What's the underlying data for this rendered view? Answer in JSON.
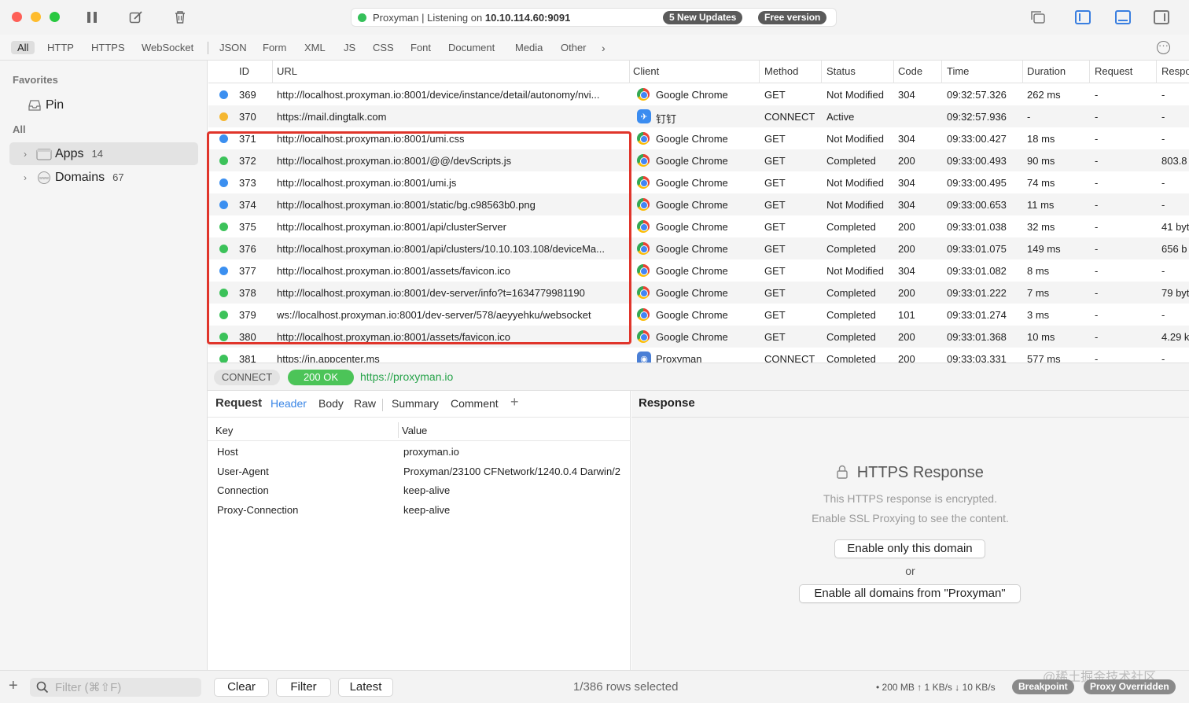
{
  "titlebar": {
    "app_status": "Proxyman | Listening on",
    "address": "10.10.114.60:9091",
    "updates_badge": "5 New Updates",
    "version_badge": "Free version"
  },
  "filters": [
    "All",
    "HTTP",
    "HTTPS",
    "WebSocket",
    "JSON",
    "Form",
    "XML",
    "JS",
    "CSS",
    "Font",
    "Document",
    "Media",
    "Other"
  ],
  "sidebar": {
    "favorites_heading": "Favorites",
    "pin_label": "Pin",
    "all_heading": "All",
    "apps_label": "Apps",
    "apps_count": "14",
    "domains_label": "Domains",
    "domains_count": "67"
  },
  "table": {
    "columns": [
      "ID",
      "URL",
      "Client",
      "Method",
      "Status",
      "Code",
      "Time",
      "Duration",
      "Request",
      "Respo"
    ],
    "rows": [
      {
        "dot": "#3b8ff0",
        "id": "369",
        "url": "http://localhost.proxyman.io:8001/device/instance/detail/autonomy/nvi...",
        "client": "Google Chrome",
        "client_icon": "chrome-icon",
        "method": "GET",
        "status": "Not Modified",
        "code": "304",
        "time": "09:32:57.326",
        "duration": "262 ms",
        "request": "-",
        "response": "-"
      },
      {
        "dot": "#f5b731",
        "id": "370",
        "url": "https://mail.dingtalk.com",
        "client": "钉钉",
        "client_icon": "dingtalk-icon",
        "method": "CONNECT",
        "status": "Active",
        "code": "",
        "time": "09:32:57.936",
        "duration": "-",
        "request": "-",
        "response": "-"
      },
      {
        "dot": "#3b8ff0",
        "id": "371",
        "url": "http://localhost.proxyman.io:8001/umi.css",
        "client": "Google Chrome",
        "client_icon": "chrome-icon",
        "method": "GET",
        "status": "Not Modified",
        "code": "304",
        "time": "09:33:00.427",
        "duration": "18 ms",
        "request": "-",
        "response": "-"
      },
      {
        "dot": "#3cc25a",
        "id": "372",
        "url": "http://localhost.proxyman.io:8001/@@/devScripts.js",
        "client": "Google Chrome",
        "client_icon": "chrome-icon",
        "method": "GET",
        "status": "Completed",
        "code": "200",
        "time": "09:33:00.493",
        "duration": "90 ms",
        "request": "-",
        "response": "803.8"
      },
      {
        "dot": "#3b8ff0",
        "id": "373",
        "url": "http://localhost.proxyman.io:8001/umi.js",
        "client": "Google Chrome",
        "client_icon": "chrome-icon",
        "method": "GET",
        "status": "Not Modified",
        "code": "304",
        "time": "09:33:00.495",
        "duration": "74 ms",
        "request": "-",
        "response": "-"
      },
      {
        "dot": "#3b8ff0",
        "id": "374",
        "url": "http://localhost.proxyman.io:8001/static/bg.c98563b0.png",
        "client": "Google Chrome",
        "client_icon": "chrome-icon",
        "method": "GET",
        "status": "Not Modified",
        "code": "304",
        "time": "09:33:00.653",
        "duration": "11 ms",
        "request": "-",
        "response": "-"
      },
      {
        "dot": "#3cc25a",
        "id": "375",
        "url": "http://localhost.proxyman.io:8001/api/clusterServer",
        "client": "Google Chrome",
        "client_icon": "chrome-icon",
        "method": "GET",
        "status": "Completed",
        "code": "200",
        "time": "09:33:01.038",
        "duration": "32 ms",
        "request": "-",
        "response": "41 byt"
      },
      {
        "dot": "#3cc25a",
        "id": "376",
        "url": "http://localhost.proxyman.io:8001/api/clusters/10.10.103.108/deviceMa...",
        "client": "Google Chrome",
        "client_icon": "chrome-icon",
        "method": "GET",
        "status": "Completed",
        "code": "200",
        "time": "09:33:01.075",
        "duration": "149 ms",
        "request": "-",
        "response": "656 b"
      },
      {
        "dot": "#3b8ff0",
        "id": "377",
        "url": "http://localhost.proxyman.io:8001/assets/favicon.ico",
        "client": "Google Chrome",
        "client_icon": "chrome-icon",
        "method": "GET",
        "status": "Not Modified",
        "code": "304",
        "time": "09:33:01.082",
        "duration": "8 ms",
        "request": "-",
        "response": "-"
      },
      {
        "dot": "#3cc25a",
        "id": "378",
        "url": "http://localhost.proxyman.io:8001/dev-server/info?t=1634779981190",
        "client": "Google Chrome",
        "client_icon": "chrome-icon",
        "method": "GET",
        "status": "Completed",
        "code": "200",
        "time": "09:33:01.222",
        "duration": "7 ms",
        "request": "-",
        "response": "79 byt"
      },
      {
        "dot": "#3cc25a",
        "id": "379",
        "url": "ws://localhost.proxyman.io:8001/dev-server/578/aeyyehku/websocket",
        "client": "Google Chrome",
        "client_icon": "chrome-icon",
        "method": "GET",
        "status": "Completed",
        "code": "101",
        "time": "09:33:01.274",
        "duration": "3 ms",
        "request": "-",
        "response": "-"
      },
      {
        "dot": "#3cc25a",
        "id": "380",
        "url": "http://localhost.proxyman.io:8001/assets/favicon.ico",
        "client": "Google Chrome",
        "client_icon": "chrome-icon",
        "method": "GET",
        "status": "Completed",
        "code": "200",
        "time": "09:33:01.368",
        "duration": "10 ms",
        "request": "-",
        "response": "4.29 k"
      },
      {
        "dot": "#3cc25a",
        "id": "381",
        "url": "https://in.appcenter.ms",
        "client": "Proxyman",
        "client_icon": "proxyman-icon",
        "method": "CONNECT",
        "status": "Completed",
        "code": "200",
        "time": "09:33:03.331",
        "duration": "577 ms",
        "request": "-",
        "response": "-"
      }
    ]
  },
  "detail": {
    "method": "CONNECT",
    "status": "200 OK",
    "url": "https://proxyman.io"
  },
  "request_pane": {
    "title": "Request",
    "tabs": [
      "Header",
      "Body",
      "Raw",
      "Summary",
      "Comment"
    ],
    "key_header": "Key",
    "value_header": "Value",
    "headers": [
      {
        "key": "Host",
        "value": "proxyman.io"
      },
      {
        "key": "User-Agent",
        "value": "Proxyman/23100 CFNetwork/1240.0.4 Darwin/2"
      },
      {
        "key": "Connection",
        "value": "keep-alive"
      },
      {
        "key": "Proxy-Connection",
        "value": "keep-alive"
      }
    ]
  },
  "response_pane": {
    "title": "Response",
    "heading": "HTTPS Response",
    "line1": "This HTTPS response is encrypted.",
    "line2": "Enable SSL Proxying to see the content.",
    "btn_domain": "Enable only this domain",
    "or": "or",
    "btn_all": "Enable all domains from \"Proxyman\""
  },
  "bottombar": {
    "filter_placeholder": "Filter (⌘⇧F)",
    "clear": "Clear",
    "filter": "Filter",
    "latest": "Latest",
    "selection": "1/386 rows selected",
    "network": "• 200 MB ↑ 1 KB/s ↓ 10 KB/s",
    "breakpoint": "Breakpoint",
    "proxy_overridden": "Proxy Overridden",
    "watermark": "@稀土掘金技术社区"
  }
}
